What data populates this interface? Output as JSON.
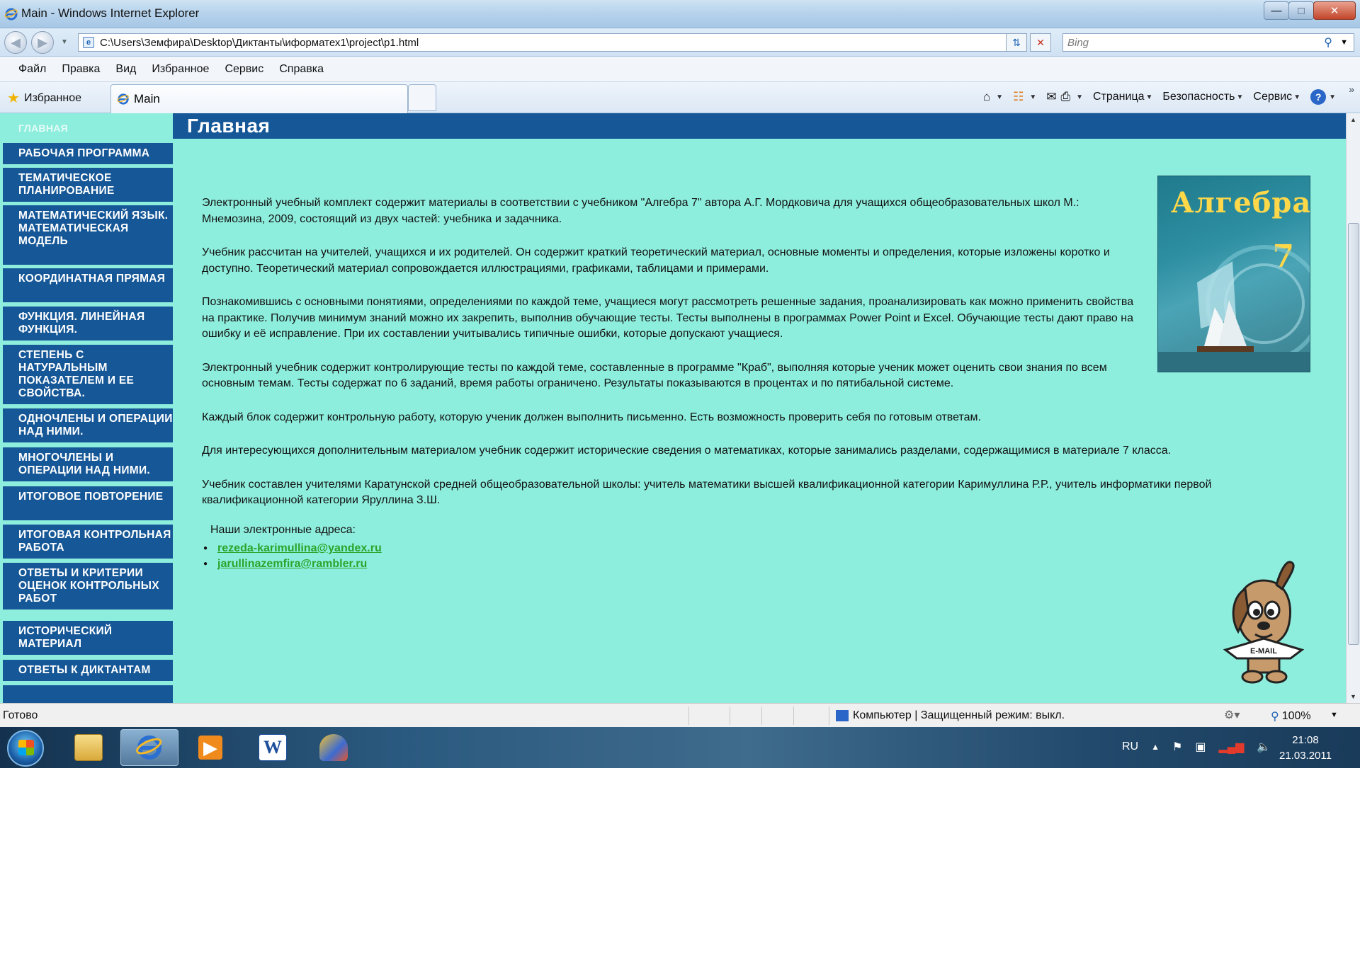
{
  "window": {
    "title": "Main - Windows Internet Explorer"
  },
  "address_bar": {
    "url": "C:\\Users\\Земфира\\Desktop\\Диктанты\\иформатех1\\project\\p1.html",
    "search_placeholder": "Bing"
  },
  "menu": [
    "Файл",
    "Правка",
    "Вид",
    "Избранное",
    "Сервис",
    "Справка"
  ],
  "favorites": {
    "label": "Избранное",
    "tab_label": "Main"
  },
  "command_bar": {
    "page": "Страница",
    "safety": "Безопасность",
    "tools": "Сервис"
  },
  "page": {
    "heading": "Главная",
    "nav": [
      {
        "label": "Главная",
        "active": true
      },
      {
        "label": "Рабочая программа",
        "active": false
      },
      {
        "label": "Тематическое планирование",
        "active": false
      },
      {
        "label": "Математический язык. Математическая модель",
        "active": false
      },
      {
        "label": "Координатная прямая",
        "active": false
      },
      {
        "label": "Функция. Линейная функция.",
        "active": false
      },
      {
        "label": "Степень с натуральным показателем и ее свойства.",
        "active": false
      },
      {
        "label": "Одночлены и операции над ними.",
        "active": false
      },
      {
        "label": "Многочлены и операции над ними.",
        "active": false
      },
      {
        "label": "Итоговое повторение",
        "active": false
      },
      {
        "label": "Итоговая контрольная работа",
        "active": false
      },
      {
        "label": "Ответы и критерии оценок контрольных работ",
        "active": false
      },
      {
        "label": "Исторический материал",
        "active": false
      },
      {
        "label": "Ответы к диктантам",
        "active": false
      }
    ],
    "paragraphs": [
      "Электронный учебный комплект содержит материалы в соответствии с учебником \"Алгебра 7\" автора А.Г. Мордковича для учащихся общеобразовательных школ М.: Мнемозина, 2009, состоящий из двух частей: учебника и задачника.",
      "Учебник рассчитан на учителей, учащихся и их родителей. Он содержит краткий теоретический материал, основные моменты и определения, которые изложены коротко и доступно. Теоретический материал сопровождается иллюстрациями, графиками, таблицами и примерами.",
      "Познакомившись с основными понятиями, определениями по каждой теме, учащиеся могут рассмотреть решенные задания, проанализировать как можно применить свойства на практике. Получив минимум знаний можно их закрепить, выполнив обучающие тесты. Тесты выполнены в программах Power Point  и Excel. Обучающие тесты дают право на ошибку и её исправление. При их составлении учитывались типичные ошибки, которые допускают учащиеся.",
      "Электронный учебник содержит контролирующие тесты по каждой теме, составленные в программе \"Краб\", выполняя которые ученик может оценить свои знания по всем основным темам. Тесты содержат по 6 заданий, время работы ограничено. Результаты показываются в процентах и по пятибальной системе.",
      "Каждый блок содержит контрольную работу, которую ученик должен выполнить письменно. Есть возможность проверить себя по готовым ответам.",
      "Для интересующихся дополнительным материалом  учебник содержит исторические сведения о математиках, которые занимались разделами, содержащимися в материале 7 класса.",
      "Учебник составлен учителями Каратунской средней общеобразовательной школы: учитель математики высшей квалификационной категории Каримуллина Р.Р., учитель информатики первой квалификационной категории Яруллина З.Ш."
    ],
    "addresses_title": "Наши электронные адреса:",
    "emails": [
      "rezeda-karimullina@yandex.ru",
      "jarullinazemfira@rambler.ru"
    ],
    "book": {
      "title": "Алгебра",
      "number": "7"
    },
    "dog_tag": "E-MAIL"
  },
  "status_bar": {
    "status": "Готово",
    "zone": "Компьютер | Защищенный режим: выкл.",
    "zoom": "100%"
  },
  "taskbar": {
    "lang": "RU",
    "time": "21:08",
    "date": "21.03.2011"
  },
  "colors": {
    "page_bg": "#8eeedd",
    "nav_bg": "#155797",
    "link": "#2aa52a"
  }
}
